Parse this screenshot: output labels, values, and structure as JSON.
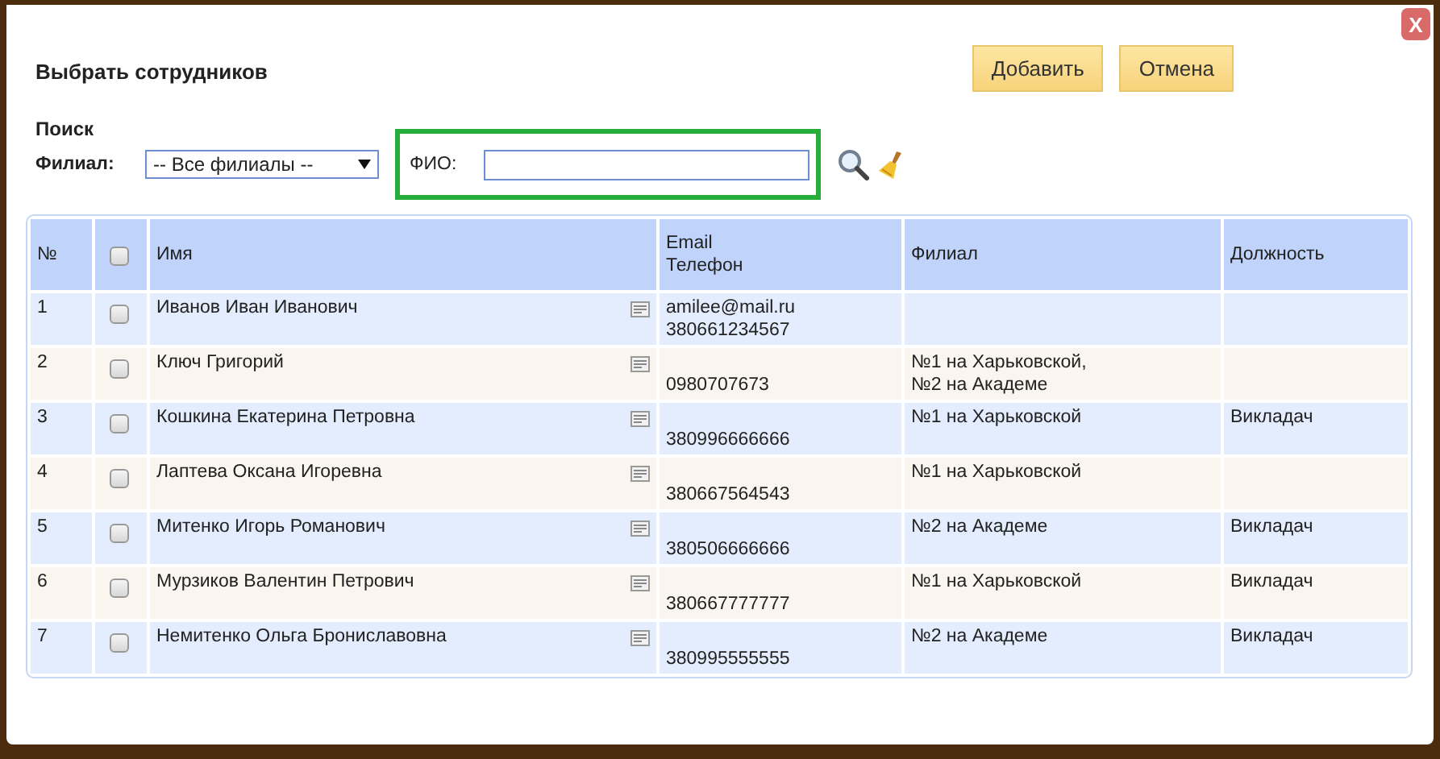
{
  "dialog": {
    "title": "Выбрать сотрудников",
    "close": "X",
    "buttons": [
      "Добавить",
      "Отмена"
    ]
  },
  "search": {
    "heading": "Поиск",
    "branch_label": "Филиал:",
    "branch_value": "-- Все филиалы --",
    "name_label": "ФИО:"
  },
  "table": {
    "columns": [
      "№",
      "Имя",
      "Email\nТелефон",
      "Филиал",
      "Должность"
    ],
    "select_all_checked": false,
    "rows": [
      {
        "number": "1",
        "checked": false,
        "name": "Иванов Иван Иванович",
        "email": "amilee@mail.ru",
        "phone": "380661234567",
        "branch": "",
        "position": ""
      },
      {
        "number": "2",
        "checked": false,
        "name": "Ключ Григорий",
        "phone": "0980707673",
        "branch": "№1 на Харьковской,\n№2 на Академе",
        "position": ""
      },
      {
        "number": "3",
        "checked": false,
        "name": "Кошкина Екатерина Петровна",
        "phone": "380996666666",
        "branch": "№1 на Харьковской",
        "position": "Викладач"
      },
      {
        "number": "4",
        "checked": false,
        "name": "Лаптева Оксана Игоревна",
        "phone": "380667564543",
        "branch": "№1 на Харьковской",
        "position": ""
      },
      {
        "number": "5",
        "checked": false,
        "name": "Митенко Игорь Романович",
        "phone": "380506666666",
        "branch": "№2 на Академе",
        "position": "Викладач"
      },
      {
        "number": "6",
        "checked": false,
        "name": "Мурзиков Валентин Петрович",
        "phone": "380667777777",
        "branch": "№1 на Харьковской",
        "position": "Викладач"
      },
      {
        "number": "7",
        "checked": false,
        "name": "Немитенко Ольга Брониславовна",
        "phone": "380995555555",
        "branch": "№2 на Академе",
        "position": "Викладач"
      }
    ]
  }
}
